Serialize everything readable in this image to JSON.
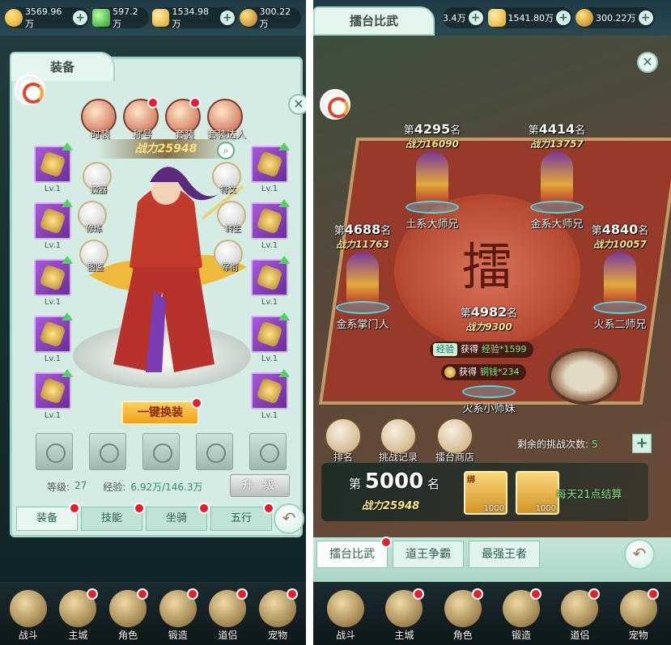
{
  "left": {
    "currency": [
      {
        "icon": "gold-coin-icon",
        "value": "3569.96万"
      },
      {
        "icon": "jade-icon",
        "value": "597.2万"
      },
      {
        "icon": "ingot-icon",
        "value": "1534.98万"
      },
      {
        "icon": "bound-gold-icon",
        "value": "300.22万"
      }
    ],
    "panel_title": "装备",
    "top_buttons": [
      "时装",
      "称号",
      "套装",
      "套装达人"
    ],
    "power": "战力25948",
    "side_buttons": [
      "魔器",
      "修炼",
      "图鉴",
      "符文",
      "转生",
      "军衔"
    ],
    "slot_levels": [
      "Lv.1",
      "Lv.1",
      "Lv.1",
      "Lv.1",
      "Lv.1",
      "Lv.1",
      "Lv.1",
      "Lv.1",
      "Lv.1",
      "Lv.1"
    ],
    "one_key_equip": "一键换装",
    "level_label": "等级:",
    "level_value": "27",
    "exp_label": "经验:",
    "exp_value": "6.92万/146.3万",
    "upgrade": "升 级",
    "sub_tabs": [
      "装备",
      "技能",
      "坐骑",
      "五行"
    ],
    "nav": [
      "战斗",
      "主城",
      "角色",
      "锻造",
      "道侣",
      "宠物"
    ]
  },
  "right": {
    "title": "擂台比武",
    "currency": [
      {
        "icon": "gold-coin-icon",
        "value": "3.4万"
      },
      {
        "icon": "ingot-icon",
        "value": "1541.80万"
      },
      {
        "icon": "bound-gold-icon",
        "value": "300.22万"
      }
    ],
    "fighters": [
      {
        "rank_prefix": "第",
        "rank": "4295",
        "rank_suffix": "名",
        "power": "战力16090",
        "name": "土系大师兄"
      },
      {
        "rank_prefix": "第",
        "rank": "4414",
        "rank_suffix": "名",
        "power": "战力13757",
        "name": "金系大师兄"
      },
      {
        "rank_prefix": "第",
        "rank": "4688",
        "rank_suffix": "名",
        "power": "战力11763",
        "name": "金系掌门人"
      },
      {
        "rank_prefix": "第",
        "rank": "4840",
        "rank_suffix": "名",
        "power": "战力10057",
        "name": "火系二师兄"
      },
      {
        "rank_prefix": "第",
        "rank": "4982",
        "rank_suffix": "名",
        "power": "战力9300",
        "name": "火系小师妹"
      }
    ],
    "arena_glyph": "擂",
    "rewards": [
      {
        "tag": "经验",
        "text": "获得",
        "amount": "经验*1599"
      },
      {
        "tag": "",
        "text": "获得",
        "amount": "铜钱*234"
      }
    ],
    "actions": [
      "排名",
      "挑战记录",
      "擂台商店"
    ],
    "remaining_label": "剩余的挑战次数:",
    "remaining_value": "5",
    "my_rank_prefix": "第",
    "my_rank": "5000",
    "my_rank_suffix": "名",
    "my_power": "战力25948",
    "prizes": [
      {
        "tag": "绑",
        "qty": "1000"
      },
      {
        "tag": "",
        "qty": "1000"
      }
    ],
    "settle": "每天21点结算",
    "tabs": [
      "擂台比武",
      "道王争霸",
      "最强王者"
    ],
    "nav": [
      "战斗",
      "主城",
      "角色",
      "锻造",
      "道侣",
      "宠物"
    ]
  }
}
